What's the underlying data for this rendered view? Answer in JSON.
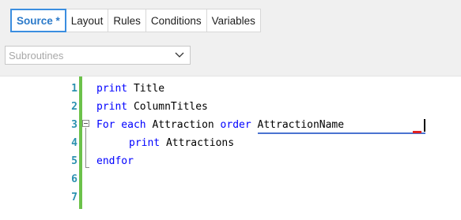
{
  "tabs": [
    {
      "label": "Source *",
      "active": true
    },
    {
      "label": "Layout",
      "active": false
    },
    {
      "label": "Rules",
      "active": false
    },
    {
      "label": "Conditions",
      "active": false
    },
    {
      "label": "Variables",
      "active": false
    }
  ],
  "combo": {
    "value": "Subroutines"
  },
  "editor": {
    "lines": [
      {
        "num": "1",
        "kw": "print",
        "rest": " Title"
      },
      {
        "num": "2",
        "kw": "print",
        "rest": " ColumnTitles"
      },
      {
        "num": "3",
        "kw": "For each",
        "rest": " Attraction ",
        "kw2": "order",
        "rest2": " AttractionName"
      },
      {
        "num": "4",
        "kw": "print",
        "rest": " Attractions"
      },
      {
        "num": "5",
        "kw": "endfor",
        "rest": ""
      },
      {
        "num": "6"
      },
      {
        "num": "7"
      }
    ]
  },
  "colors": {
    "accent": "#2b7ac9",
    "keyword": "#0000ff",
    "line_number": "#2b91af",
    "change_bar": "#6cc24a"
  }
}
